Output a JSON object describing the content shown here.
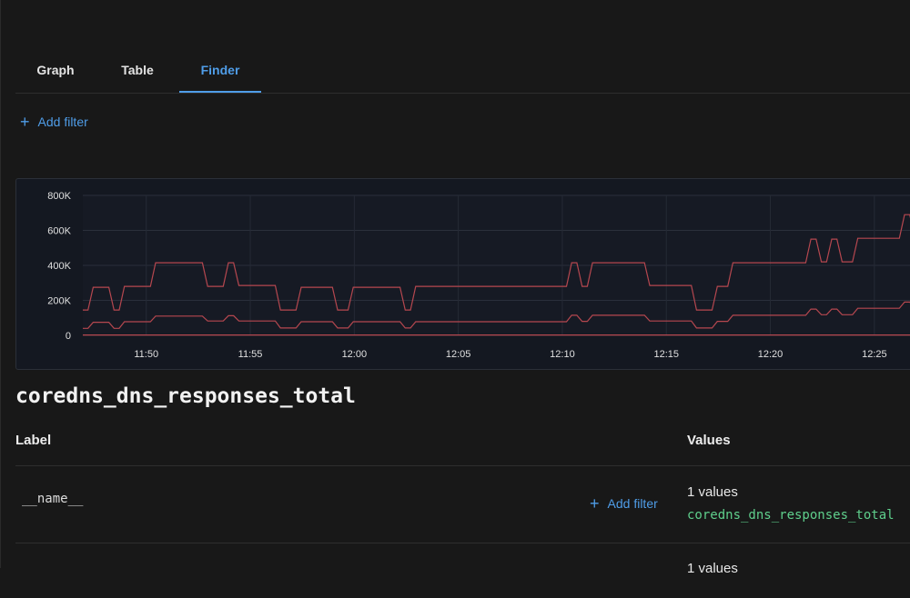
{
  "tabs": [
    {
      "label": "Graph",
      "active": false
    },
    {
      "label": "Table",
      "active": false
    },
    {
      "label": "Finder",
      "active": true
    }
  ],
  "add_filter_label": "Add filter",
  "metric_name": "coredns_dns_responses_total",
  "table": {
    "label_header": "Label",
    "values_header": "Values",
    "rows": [
      {
        "label": "__name__",
        "add_filter": "Add filter",
        "count": "1 values",
        "value": "coredns_dns_responses_total"
      },
      {
        "label": "",
        "add_filter": "",
        "count": "1 values",
        "value": ""
      }
    ]
  },
  "colors": {
    "accent": "#4f9de8",
    "series": "#b5474f",
    "value_text": "#5fcf8c"
  },
  "chart_data": {
    "type": "line",
    "y_ticks": [
      "800K",
      "600K",
      "400K",
      "200K",
      "0"
    ],
    "x_ticks": [
      "11:50",
      "11:55",
      "12:00",
      "12:05",
      "12:10",
      "12:15",
      "12:20",
      "12:25"
    ],
    "x_tick_minutes": [
      50,
      55,
      60,
      65,
      70,
      75,
      80,
      85
    ],
    "x_range_minutes": [
      46.95,
      87.5
    ],
    "ylim": [
      0,
      800000
    ],
    "series": [
      {
        "points": [
          [
            46.95,
            145000
          ],
          [
            47.2,
            145000
          ],
          [
            47.45,
            275000
          ],
          [
            48.2,
            275000
          ],
          [
            48.45,
            145000
          ],
          [
            48.7,
            145000
          ],
          [
            48.95,
            280000
          ],
          [
            50.2,
            280000
          ],
          [
            50.45,
            415000
          ],
          [
            52.7,
            415000
          ],
          [
            52.95,
            280000
          ],
          [
            53.7,
            280000
          ],
          [
            53.95,
            415000
          ],
          [
            54.2,
            415000
          ],
          [
            54.45,
            285000
          ],
          [
            56.2,
            285000
          ],
          [
            56.45,
            145000
          ],
          [
            57.2,
            145000
          ],
          [
            57.45,
            275000
          ],
          [
            58.95,
            275000
          ],
          [
            59.2,
            145000
          ],
          [
            59.7,
            145000
          ],
          [
            59.95,
            275000
          ],
          [
            62.2,
            275000
          ],
          [
            62.45,
            145000
          ],
          [
            62.7,
            145000
          ],
          [
            62.95,
            280000
          ],
          [
            70.2,
            280000
          ],
          [
            70.45,
            415000
          ],
          [
            70.7,
            415000
          ],
          [
            70.95,
            280000
          ],
          [
            71.2,
            280000
          ],
          [
            71.45,
            415000
          ],
          [
            73.95,
            415000
          ],
          [
            74.2,
            285000
          ],
          [
            76.2,
            285000
          ],
          [
            76.45,
            145000
          ],
          [
            77.2,
            145000
          ],
          [
            77.45,
            280000
          ],
          [
            77.95,
            280000
          ],
          [
            78.2,
            415000
          ],
          [
            81.7,
            415000
          ],
          [
            81.95,
            550000
          ],
          [
            82.2,
            550000
          ],
          [
            82.45,
            420000
          ],
          [
            82.7,
            420000
          ],
          [
            82.95,
            550000
          ],
          [
            83.2,
            550000
          ],
          [
            83.45,
            420000
          ],
          [
            83.95,
            420000
          ],
          [
            84.2,
            555000
          ],
          [
            86.2,
            555000
          ],
          [
            86.45,
            690000
          ],
          [
            86.7,
            690000
          ],
          [
            86.95,
            560000
          ],
          [
            87.5,
            560000
          ]
        ]
      },
      {
        "points": [
          [
            46.95,
            40000
          ],
          [
            47.2,
            40000
          ],
          [
            47.45,
            75000
          ],
          [
            48.2,
            75000
          ],
          [
            48.45,
            40000
          ],
          [
            48.7,
            40000
          ],
          [
            48.95,
            78000
          ],
          [
            50.2,
            78000
          ],
          [
            50.45,
            110000
          ],
          [
            52.7,
            110000
          ],
          [
            52.95,
            82000
          ],
          [
            53.7,
            82000
          ],
          [
            53.95,
            112000
          ],
          [
            54.2,
            112000
          ],
          [
            54.45,
            82000
          ],
          [
            56.2,
            82000
          ],
          [
            56.45,
            42000
          ],
          [
            57.2,
            42000
          ],
          [
            57.45,
            78000
          ],
          [
            58.95,
            78000
          ],
          [
            59.2,
            42000
          ],
          [
            59.7,
            42000
          ],
          [
            59.95,
            78000
          ],
          [
            62.2,
            78000
          ],
          [
            62.45,
            42000
          ],
          [
            62.7,
            42000
          ],
          [
            62.95,
            78000
          ],
          [
            70.2,
            78000
          ],
          [
            70.45,
            115000
          ],
          [
            70.7,
            115000
          ],
          [
            70.95,
            80000
          ],
          [
            71.2,
            80000
          ],
          [
            71.45,
            115000
          ],
          [
            73.95,
            115000
          ],
          [
            74.2,
            82000
          ],
          [
            76.2,
            82000
          ],
          [
            76.45,
            42000
          ],
          [
            77.2,
            42000
          ],
          [
            77.45,
            80000
          ],
          [
            77.95,
            80000
          ],
          [
            78.2,
            115000
          ],
          [
            81.7,
            115000
          ],
          [
            81.95,
            150000
          ],
          [
            82.2,
            150000
          ],
          [
            82.45,
            118000
          ],
          [
            82.7,
            118000
          ],
          [
            82.95,
            150000
          ],
          [
            83.2,
            150000
          ],
          [
            83.45,
            118000
          ],
          [
            83.95,
            118000
          ],
          [
            84.2,
            155000
          ],
          [
            86.2,
            155000
          ],
          [
            86.45,
            190000
          ],
          [
            86.7,
            190000
          ],
          [
            86.95,
            158000
          ],
          [
            87.5,
            158000
          ]
        ]
      },
      {
        "points": [
          [
            46.95,
            2000
          ],
          [
            87.5,
            2000
          ]
        ]
      }
    ]
  }
}
